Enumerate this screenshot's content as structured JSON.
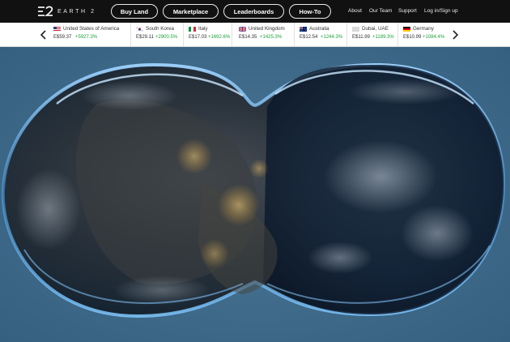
{
  "nav": {
    "logo_text": "EARTH 2",
    "buttons": [
      "Buy Land",
      "Marketplace",
      "Leaderboards",
      "How-To"
    ],
    "links": [
      "About",
      "Our Team",
      "Support",
      "Log in/Sign up"
    ]
  },
  "ticker": {
    "items": [
      {
        "country": "United States of America",
        "price": "E$59.37",
        "change": "+5927.3%",
        "flag": "us-flag-icon"
      },
      {
        "country": "South Korea",
        "price": "E$29.11",
        "change": "+2900.5%",
        "flag": "kr-flag-icon"
      },
      {
        "country": "Italy",
        "price": "E$17.03",
        "change": "+1692.6%",
        "flag": "it-flag-icon"
      },
      {
        "country": "United Kingdom",
        "price": "E$14.35",
        "change": "+1425.3%",
        "flag": "gb-flag-icon"
      },
      {
        "country": "Australia",
        "price": "E$12.54",
        "change": "+1244.3%",
        "flag": "au-flag-icon"
      },
      {
        "country": "Dubai, UAE",
        "price": "E$11.99",
        "change": "+1189.3%",
        "flag": "ae-flag-icon"
      },
      {
        "country": "Germany",
        "price": "E$10.99",
        "change": "+1084.4%",
        "flag": "de-flag-icon"
      }
    ]
  },
  "colors": {
    "nav_bg": "#111111",
    "change_green": "#1ea23a",
    "hero_bg": "#3f6a8a"
  }
}
